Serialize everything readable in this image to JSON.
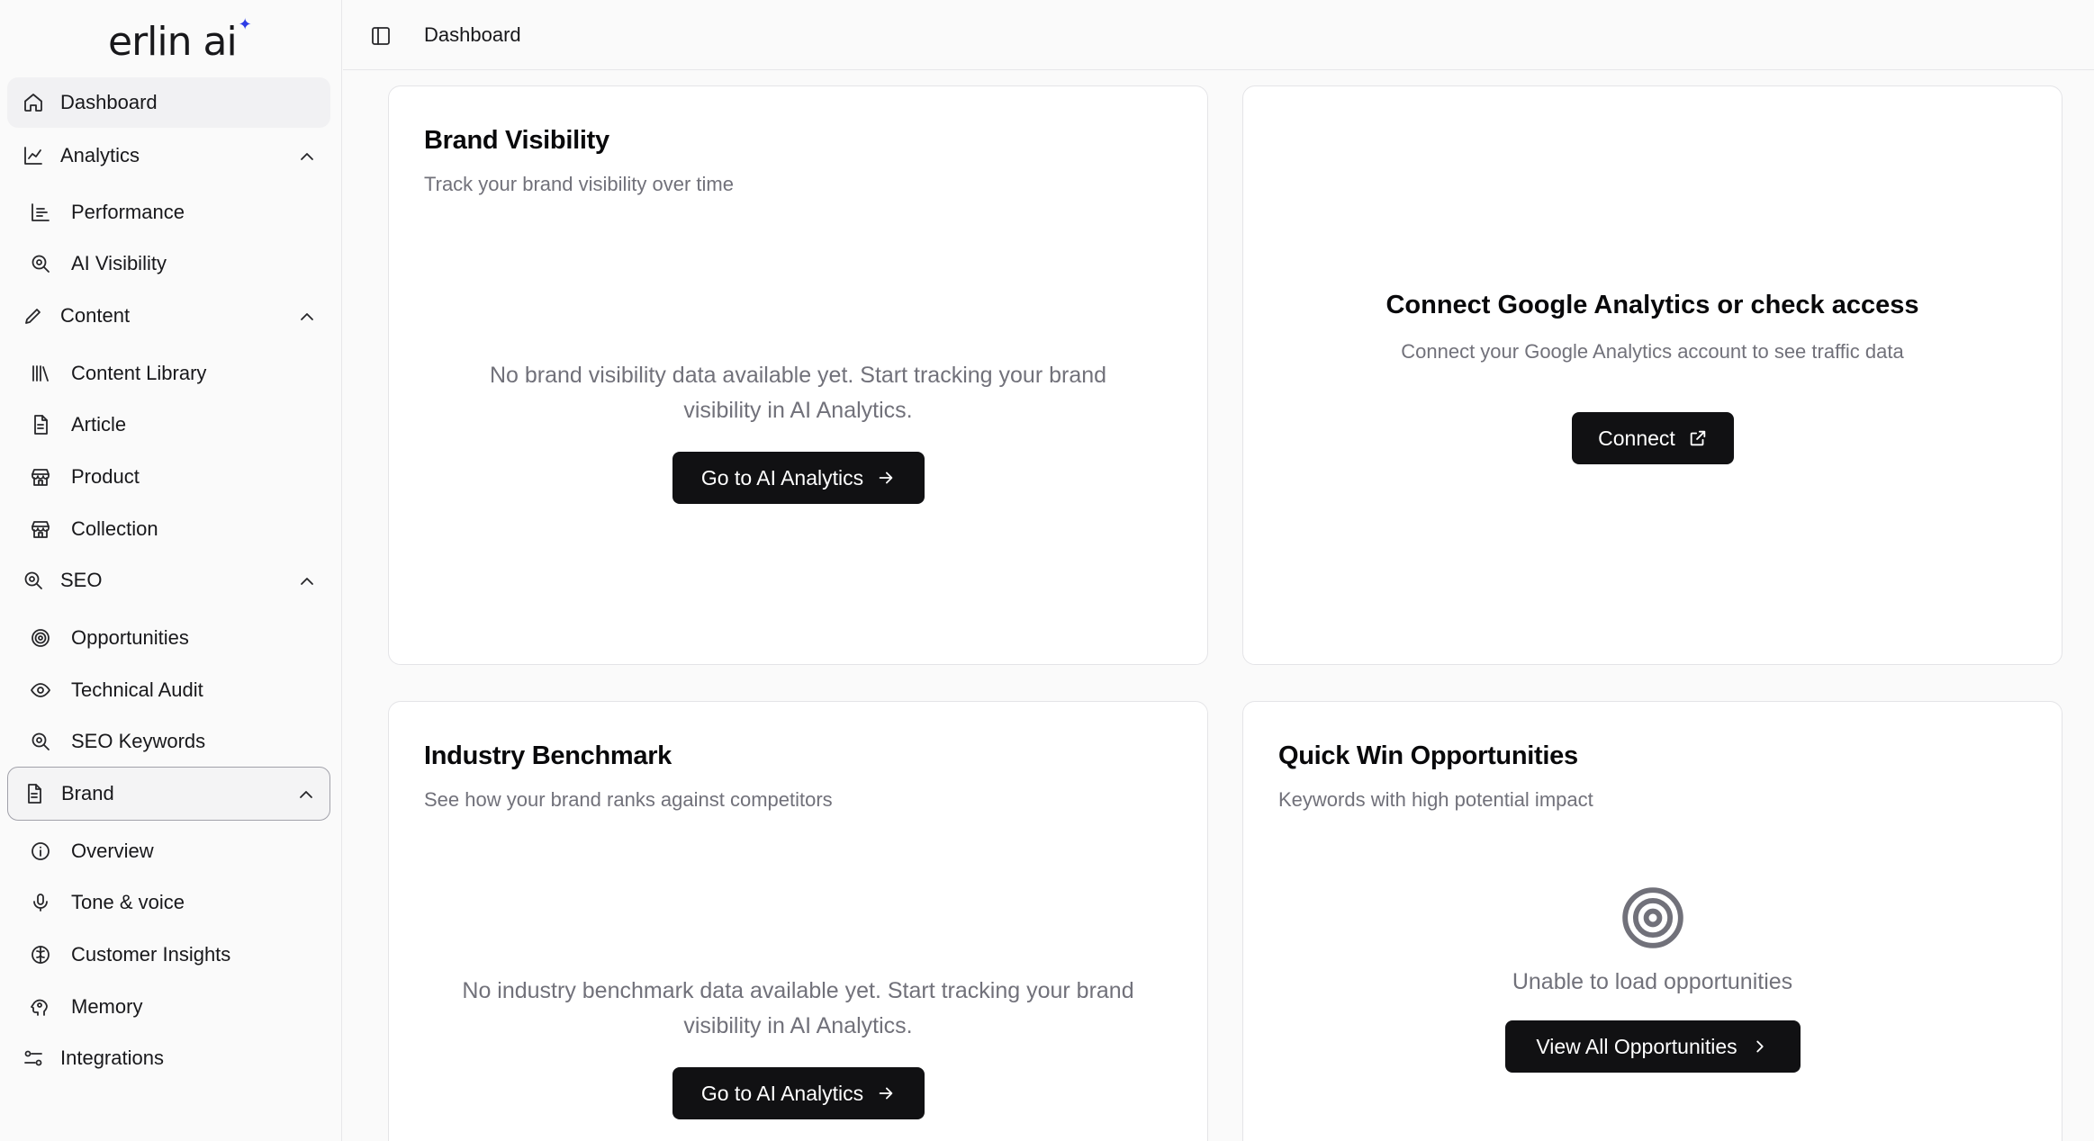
{
  "brand": {
    "logo_text": "erlin ai"
  },
  "header": {
    "breadcrumb": "Dashboard"
  },
  "sidebar": {
    "dashboard": "Dashboard",
    "analytics": {
      "label": "Analytics",
      "items": [
        "Performance",
        "AI Visibility"
      ]
    },
    "content": {
      "label": "Content",
      "items": [
        "Content Library",
        "Article",
        "Product",
        "Collection"
      ]
    },
    "seo": {
      "label": "SEO",
      "items": [
        "Opportunities",
        "Technical Audit",
        "SEO Keywords"
      ]
    },
    "brand": {
      "label": "Brand",
      "items": [
        "Overview",
        "Tone & voice",
        "Customer Insights",
        "Memory"
      ]
    },
    "integrations": "Integrations"
  },
  "cards": {
    "brand_visibility": {
      "title": "Brand Visibility",
      "subtitle": "Track your brand visibility over time",
      "empty_line1": "No brand visibility data available yet. Start tracking your brand",
      "empty_line2": "visibility in AI Analytics.",
      "button": "Go to AI Analytics"
    },
    "google_analytics": {
      "title": "Connect Google Analytics or check access",
      "subtitle": "Connect your Google Analytics account to see traffic data",
      "button": "Connect"
    },
    "industry_benchmark": {
      "title": "Industry Benchmark",
      "subtitle": "See how your brand ranks against competitors",
      "empty_line1": "No industry benchmark data available yet. Start tracking your brand",
      "empty_line2": "visibility in AI Analytics.",
      "button": "Go to AI Analytics"
    },
    "quick_wins": {
      "title": "Quick Win Opportunities",
      "subtitle": "Keywords with high potential impact",
      "error": "Unable to load opportunities",
      "button": "View All Opportunities"
    }
  },
  "colors": {
    "accent_star": "#2d3ce6",
    "button_bg": "#111113",
    "muted_text": "#71717a"
  }
}
